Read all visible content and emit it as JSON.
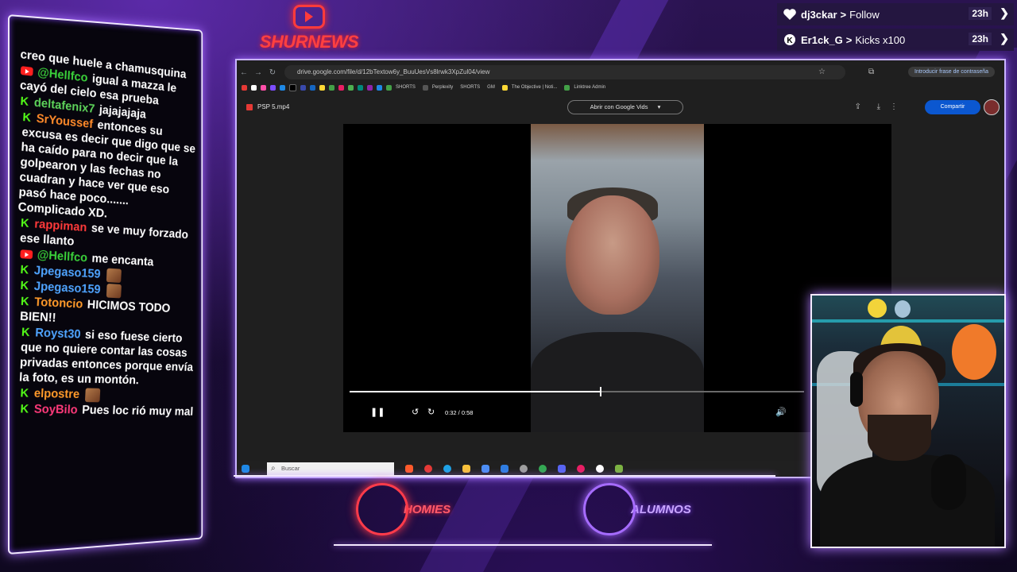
{
  "logo": {
    "title": "SHURNEWS"
  },
  "alerts": [
    {
      "user": "dj3ckar",
      "action": "Follow",
      "time": "23h"
    },
    {
      "user": "Er1ck_G",
      "action": "Kicks x100",
      "time": "23h"
    }
  ],
  "chat": {
    "messages": [
      {
        "platform": "none",
        "user": "",
        "user_color": "#ffffff",
        "text": "creo que huele a chamusquina"
      },
      {
        "platform": "youtube",
        "user": "@Hellfco",
        "user_color": "#3ad13a",
        "text": "igual a mazza le cayó del cielo esa prueba"
      },
      {
        "platform": "kick",
        "user": "deltafenix7",
        "user_color": "#5dd35a",
        "text": "jajajajaja"
      },
      {
        "platform": "kick",
        "user": "SrYoussef",
        "user_color": "#ff8a2a",
        "text": "entonces su excusa es decir que digo que se ha caído para no decir que la golpearon y las fechas no cuadran y hace ver que eso pasó hace poco....... Complicado XD."
      },
      {
        "platform": "kick",
        "user": "rappiman",
        "user_color": "#ff3a3a",
        "text": "se ve muy forzado ese llanto"
      },
      {
        "platform": "youtube",
        "user": "@Hellfco",
        "user_color": "#3ad13a",
        "text": "me encanta"
      },
      {
        "platform": "kick",
        "user": "Jpegaso159",
        "user_color": "#4fa4ff",
        "text": ""
      },
      {
        "platform": "kick",
        "user": "Jpegaso159",
        "user_color": "#4fa4ff",
        "text": ""
      },
      {
        "platform": "kick",
        "user": "Totoncio",
        "user_color": "#ff9a2a",
        "text": "HICIMOS TODO BIEN!!"
      },
      {
        "platform": "kick",
        "user": "Royst30",
        "user_color": "#4fa4ff",
        "text": "si eso fuese cierto que no quiere contar las cosas privadas entonces porque envía la foto, es un montón."
      },
      {
        "platform": "kick",
        "user": "elpostre",
        "user_color": "#ff9a2a",
        "text": ""
      },
      {
        "platform": "kick",
        "user": "SoyBilo",
        "user_color": "#ff3a7a",
        "text": "Pues loc rió muy mal"
      }
    ]
  },
  "browser": {
    "url": "drive.google.com/file/d/12bTextow6y_BuuUesVs8lrwk3XpZul04/view",
    "password_chip": "Introducir frase de contraseña",
    "bookmarks": [
      "SHORTS",
      "Perplexity",
      "SHORTS",
      "GM",
      "The Objective | Noti...",
      "Linktree Admin"
    ],
    "file_name": "PSP 5.mp4",
    "open_with": "Abrir con Google Vids",
    "share": "Compartir",
    "player": {
      "current": "0:32",
      "duration": "0:58",
      "progress": 0.552,
      "time_label": "0:32 / 0:58"
    },
    "taskbar_search": "Buscar"
  },
  "teams": [
    {
      "name": "HOMIES",
      "color": "#ff3b4a"
    },
    {
      "name": "ALUMNOS",
      "color": "#a66cff"
    }
  ]
}
